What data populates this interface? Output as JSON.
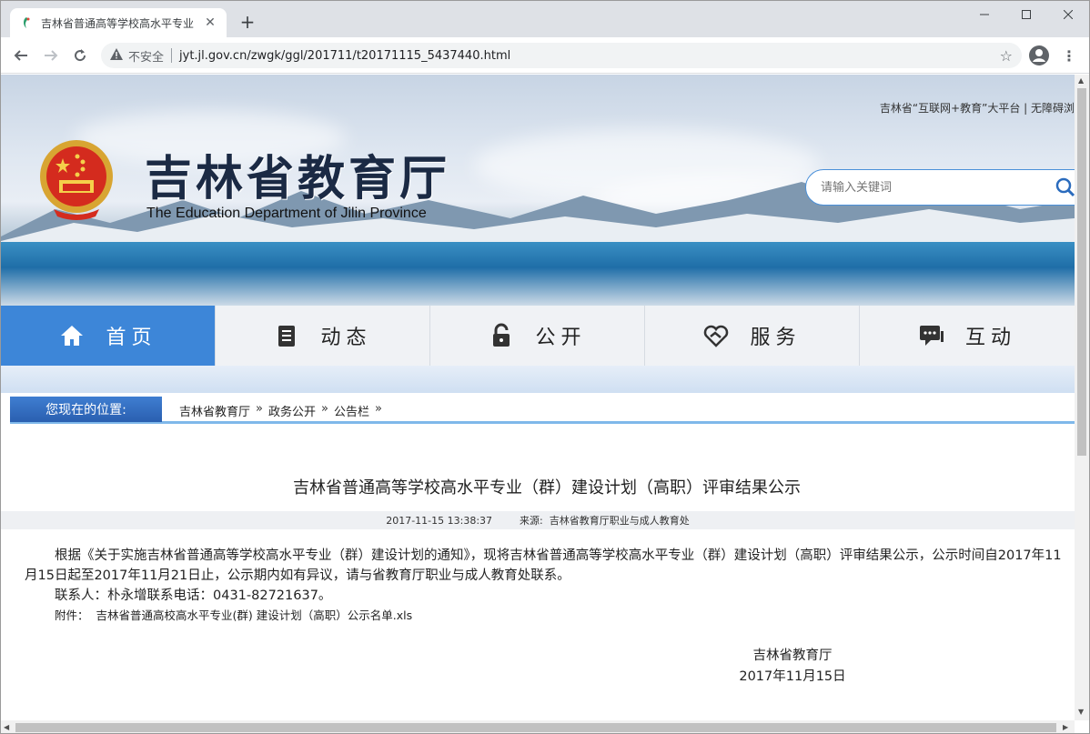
{
  "browser": {
    "tab_title": "吉林省普通高等学校高水平专业",
    "new_tab": "+",
    "tab_close": "✕",
    "insecure_label": "不安全",
    "url": "jyt.jl.gov.cn/zwgk/ggl/201711/t20171115_5437440.html"
  },
  "header": {
    "top_links": "吉林省“互联网+教育”大平台 | 无障碍浏",
    "title": "吉林省教育厅",
    "subtitle": "The Education Department of Jilin Province",
    "search_placeholder": "请输入关键词"
  },
  "nav": {
    "items": [
      {
        "label": "首页",
        "icon": "home-icon"
      },
      {
        "label": "动态",
        "icon": "document-icon"
      },
      {
        "label": "公开",
        "icon": "lock-icon"
      },
      {
        "label": "服务",
        "icon": "handshake-icon"
      },
      {
        "label": "互动",
        "icon": "chat-icon"
      }
    ]
  },
  "breadcrumb": {
    "label": "您现在的位置:",
    "items": [
      "吉林省教育厅",
      "政务公开",
      "公告栏"
    ],
    "separator": "»"
  },
  "article": {
    "title": "吉林省普通高等学校高水平专业（群）建设计划（高职）评审结果公示",
    "date": "2017-11-15 13:38:37",
    "source_label": "来源:",
    "source": "吉林省教育厅职业与成人教育处",
    "paragraph1": "根据《关于实施吉林省普通高等学校高水平专业（群）建设计划的通知》，现将吉林省普通高等学校高水平专业（群）建设计划（高职）评审结果公示，公示时间自2017年11月15日起至2017年11月21日止，公示期内如有异议，请与省教育厅职业与成人教育处联系。",
    "contact": "联系人：朴永增联系电话：0431-82721637。",
    "attachment_label": "附件：",
    "attachment_file": "吉林省普通高校高水平专业(群) 建设计划（高职）公示名单.xls",
    "signature_org": "吉林省教育厅",
    "signature_date": "2017年11月15日"
  }
}
